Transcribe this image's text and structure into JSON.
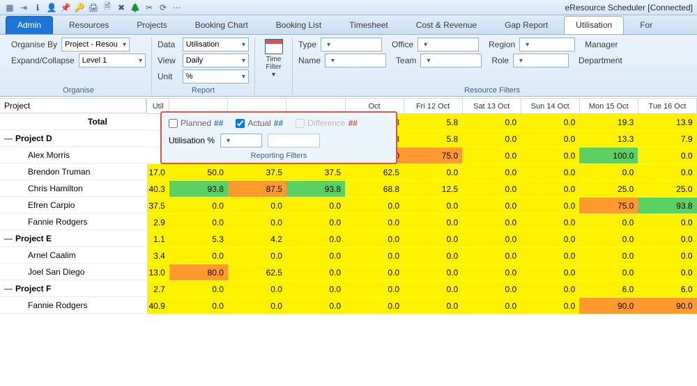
{
  "app_title": "eResource Scheduler [Connected]",
  "toolbar_icons": [
    "grid",
    "exit",
    "info",
    "user",
    "pin",
    "key",
    "print",
    "sheet",
    "x-sheet",
    "tree",
    "scissors",
    "refresh",
    "options"
  ],
  "tabs": [
    "Admin",
    "Resources",
    "Projects",
    "Booking Chart",
    "Booking List",
    "Timesheet",
    "Cost & Revenue",
    "Gap Report",
    "Utilisation",
    "For"
  ],
  "active_admin_tab": "Admin",
  "active_page_tab": "Utilisation",
  "ribbon": {
    "organise": {
      "label": "Organise",
      "organise_by": "Organise By",
      "organise_by_value": "Project - Resou",
      "expand_collapse": "Expand/Collapse",
      "expand_collapse_value": "Level 1"
    },
    "report": {
      "label": "Report",
      "data": "Data",
      "data_value": "Utilisation",
      "view": "View",
      "view_value": "Daily",
      "unit": "Unit",
      "unit_value": "%"
    },
    "time_filter": "Time Filter ▾",
    "filters": {
      "type": "Type",
      "office": "Office",
      "region": "Region",
      "manager": "Manager",
      "name": "Name",
      "team": "Team",
      "role": "Role",
      "department": "Department",
      "label": "Resource Filters"
    }
  },
  "report_panel": {
    "planned": "Planned",
    "actual": "Actual",
    "difference": "Difference",
    "hash": "##",
    "actual_checked": true,
    "planned_checked": false,
    "difference_checked": false,
    "utilisation": "Utilisation %",
    "title": "Reporting Filters"
  },
  "grid": {
    "project_header": "Project",
    "util_header": "Util",
    "date_headers": [
      "Oct",
      "Fri 12 Oct",
      "Sat 13 Oct",
      "Sun 14 Oct",
      "Mon 15 Oct",
      "Tue 16 Oct"
    ],
    "rows": [
      {
        "label": "Total",
        "type": "total",
        "cells": [
          {
            "v": "13.8",
            "c": "yellow"
          },
          {
            "v": "5.8",
            "c": "yellow"
          },
          {
            "v": "0.0",
            "c": "yellow"
          },
          {
            "v": "0.0",
            "c": "yellow"
          },
          {
            "v": "19.3",
            "c": "yellow"
          },
          {
            "v": "13.9",
            "c": "yellow"
          }
        ]
      },
      {
        "label": "Project D",
        "type": "lvl1",
        "exp": "—",
        "cells": [
          {
            "v": "13.8",
            "c": "yellow"
          },
          {
            "v": "5.8",
            "c": "yellow"
          },
          {
            "v": "0.0",
            "c": "yellow"
          },
          {
            "v": "0.0",
            "c": "yellow"
          },
          {
            "v": "13.3",
            "c": "yellow"
          },
          {
            "v": "7.9",
            "c": "yellow"
          }
        ]
      },
      {
        "label": "Alex Morris",
        "type": "lvl2",
        "cells": [
          {
            "v": "75.0",
            "c": "orange"
          },
          {
            "v": "75.0",
            "c": "orange"
          },
          {
            "v": "0.0",
            "c": "yellow"
          },
          {
            "v": "0.0",
            "c": "yellow"
          },
          {
            "v": "100.0",
            "c": "green"
          },
          {
            "v": "0.0",
            "c": "yellow"
          }
        ]
      },
      {
        "label": "Brendon Truman",
        "type": "lvl2",
        "pre": [
          {
            "v": "17.0",
            "c": "yellow"
          },
          {
            "v": "50.0",
            "c": "yellow"
          },
          {
            "v": "37.5",
            "c": "yellow"
          },
          {
            "v": "37.5",
            "c": "yellow"
          }
        ],
        "cells": [
          {
            "v": "62.5",
            "c": "yellow"
          },
          {
            "v": "0.0",
            "c": "yellow"
          },
          {
            "v": "0.0",
            "c": "yellow"
          },
          {
            "v": "0.0",
            "c": "yellow"
          },
          {
            "v": "0.0",
            "c": "yellow"
          },
          {
            "v": "0.0",
            "c": "yellow"
          }
        ]
      },
      {
        "label": "Chris Hamilton",
        "type": "lvl2",
        "pre": [
          {
            "v": "40.3",
            "c": "yellow"
          },
          {
            "v": "93.8",
            "c": "green"
          },
          {
            "v": "87.5",
            "c": "orange"
          },
          {
            "v": "93.8",
            "c": "green"
          }
        ],
        "cells": [
          {
            "v": "68.8",
            "c": "yellow"
          },
          {
            "v": "12.5",
            "c": "yellow"
          },
          {
            "v": "0.0",
            "c": "yellow"
          },
          {
            "v": "0.0",
            "c": "yellow"
          },
          {
            "v": "25.0",
            "c": "yellow"
          },
          {
            "v": "25.0",
            "c": "yellow"
          }
        ]
      },
      {
        "label": "Efren Carpio",
        "type": "lvl2",
        "pre": [
          {
            "v": "37.5",
            "c": "yellow"
          },
          {
            "v": "0.0",
            "c": "yellow"
          },
          {
            "v": "0.0",
            "c": "yellow"
          },
          {
            "v": "0.0",
            "c": "yellow"
          }
        ],
        "cells": [
          {
            "v": "0.0",
            "c": "yellow"
          },
          {
            "v": "0.0",
            "c": "yellow"
          },
          {
            "v": "0.0",
            "c": "yellow"
          },
          {
            "v": "0.0",
            "c": "yellow"
          },
          {
            "v": "75.0",
            "c": "orange"
          },
          {
            "v": "93.8",
            "c": "green"
          }
        ]
      },
      {
        "label": "Fannie Rodgers",
        "type": "lvl2",
        "pre": [
          {
            "v": "2.9",
            "c": "yellow"
          },
          {
            "v": "0.0",
            "c": "yellow"
          },
          {
            "v": "0.0",
            "c": "yellow"
          },
          {
            "v": "0.0",
            "c": "yellow"
          }
        ],
        "cells": [
          {
            "v": "0.0",
            "c": "yellow"
          },
          {
            "v": "0.0",
            "c": "yellow"
          },
          {
            "v": "0.0",
            "c": "yellow"
          },
          {
            "v": "0.0",
            "c": "yellow"
          },
          {
            "v": "0.0",
            "c": "yellow"
          },
          {
            "v": "0.0",
            "c": "yellow"
          }
        ]
      },
      {
        "label": "Project E",
        "type": "lvl1",
        "exp": "—",
        "pre": [
          {
            "v": "1.1",
            "c": "yellow"
          },
          {
            "v": "5.3",
            "c": "yellow"
          },
          {
            "v": "4.2",
            "c": "yellow"
          },
          {
            "v": "0.0",
            "c": "yellow"
          }
        ],
        "cells": [
          {
            "v": "0.0",
            "c": "yellow"
          },
          {
            "v": "0.0",
            "c": "yellow"
          },
          {
            "v": "0.0",
            "c": "yellow"
          },
          {
            "v": "0.0",
            "c": "yellow"
          },
          {
            "v": "0.0",
            "c": "yellow"
          },
          {
            "v": "0.0",
            "c": "yellow"
          }
        ]
      },
      {
        "label": "Arnel Caalim",
        "type": "lvl2",
        "pre": [
          {
            "v": "3.4",
            "c": "yellow"
          },
          {
            "v": "0.0",
            "c": "yellow"
          },
          {
            "v": "0.0",
            "c": "yellow"
          },
          {
            "v": "0.0",
            "c": "yellow"
          }
        ],
        "cells": [
          {
            "v": "0.0",
            "c": "yellow"
          },
          {
            "v": "0.0",
            "c": "yellow"
          },
          {
            "v": "0.0",
            "c": "yellow"
          },
          {
            "v": "0.0",
            "c": "yellow"
          },
          {
            "v": "0.0",
            "c": "yellow"
          },
          {
            "v": "0.0",
            "c": "yellow"
          }
        ]
      },
      {
        "label": "Joel San Diego",
        "type": "lvl2",
        "pre": [
          {
            "v": "13.0",
            "c": "yellow"
          },
          {
            "v": "80.0",
            "c": "orange"
          },
          {
            "v": "62.5",
            "c": "yellow"
          },
          {
            "v": "0.0",
            "c": "yellow"
          }
        ],
        "cells": [
          {
            "v": "0.0",
            "c": "yellow"
          },
          {
            "v": "0.0",
            "c": "yellow"
          },
          {
            "v": "0.0",
            "c": "yellow"
          },
          {
            "v": "0.0",
            "c": "yellow"
          },
          {
            "v": "0.0",
            "c": "yellow"
          },
          {
            "v": "0.0",
            "c": "yellow"
          }
        ]
      },
      {
        "label": "Project F",
        "type": "lvl1",
        "exp": "—",
        "pre": [
          {
            "v": "2.7",
            "c": "yellow"
          },
          {
            "v": "0.0",
            "c": "yellow"
          },
          {
            "v": "0.0",
            "c": "yellow"
          },
          {
            "v": "0.0",
            "c": "yellow"
          }
        ],
        "cells": [
          {
            "v": "0.0",
            "c": "yellow"
          },
          {
            "v": "0.0",
            "c": "yellow"
          },
          {
            "v": "0.0",
            "c": "yellow"
          },
          {
            "v": "0.0",
            "c": "yellow"
          },
          {
            "v": "6.0",
            "c": "yellow"
          },
          {
            "v": "6.0",
            "c": "yellow"
          }
        ]
      },
      {
        "label": "Fannie Rodgers",
        "type": "lvl2",
        "pre": [
          {
            "v": "40.9",
            "c": "yellow"
          },
          {
            "v": "0.0",
            "c": "yellow"
          },
          {
            "v": "0.0",
            "c": "yellow"
          },
          {
            "v": "0.0",
            "c": "yellow"
          }
        ],
        "cells": [
          {
            "v": "0.0",
            "c": "yellow"
          },
          {
            "v": "0.0",
            "c": "yellow"
          },
          {
            "v": "0.0",
            "c": "yellow"
          },
          {
            "v": "0.0",
            "c": "yellow"
          },
          {
            "v": "90.0",
            "c": "orange"
          },
          {
            "v": "90.0",
            "c": "orange"
          }
        ]
      }
    ]
  }
}
